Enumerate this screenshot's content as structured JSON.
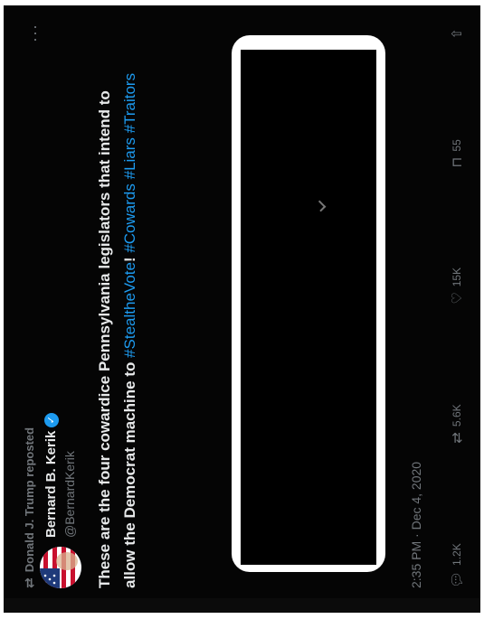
{
  "repost": {
    "icon": "repost-icon",
    "text": "Donald J. Trump reposted"
  },
  "author": {
    "display_name": "Bernard B. Kerik",
    "verified_icon": "verified-badge-icon",
    "handle": "@BernardKerik"
  },
  "menu_icon": "more-options-icon",
  "tweet": {
    "text_plain": "These are the four cowardice Pennsylvania legislators that intend to allow the Democrat machine to ",
    "hashtags": [
      "#StealtheVote",
      "! ",
      "#Cowards",
      " ",
      "#Liars",
      " ",
      "#Traitors"
    ]
  },
  "timestamp": "2:35 PM · Dec 4, 2020",
  "actions": {
    "reply": {
      "icon": "reply-icon",
      "count": "1.2K"
    },
    "repost": {
      "icon": "repost-icon",
      "count": "5.6K"
    },
    "like": {
      "icon": "heart-icon",
      "count": "15K"
    },
    "bookmark": {
      "icon": "bookmark-icon",
      "count": "55"
    },
    "share": {
      "icon": "share-icon"
    }
  },
  "colors": {
    "background": "#050505",
    "text": "#e7e9ea",
    "muted": "#71767b",
    "link": "#1d9bf0"
  }
}
